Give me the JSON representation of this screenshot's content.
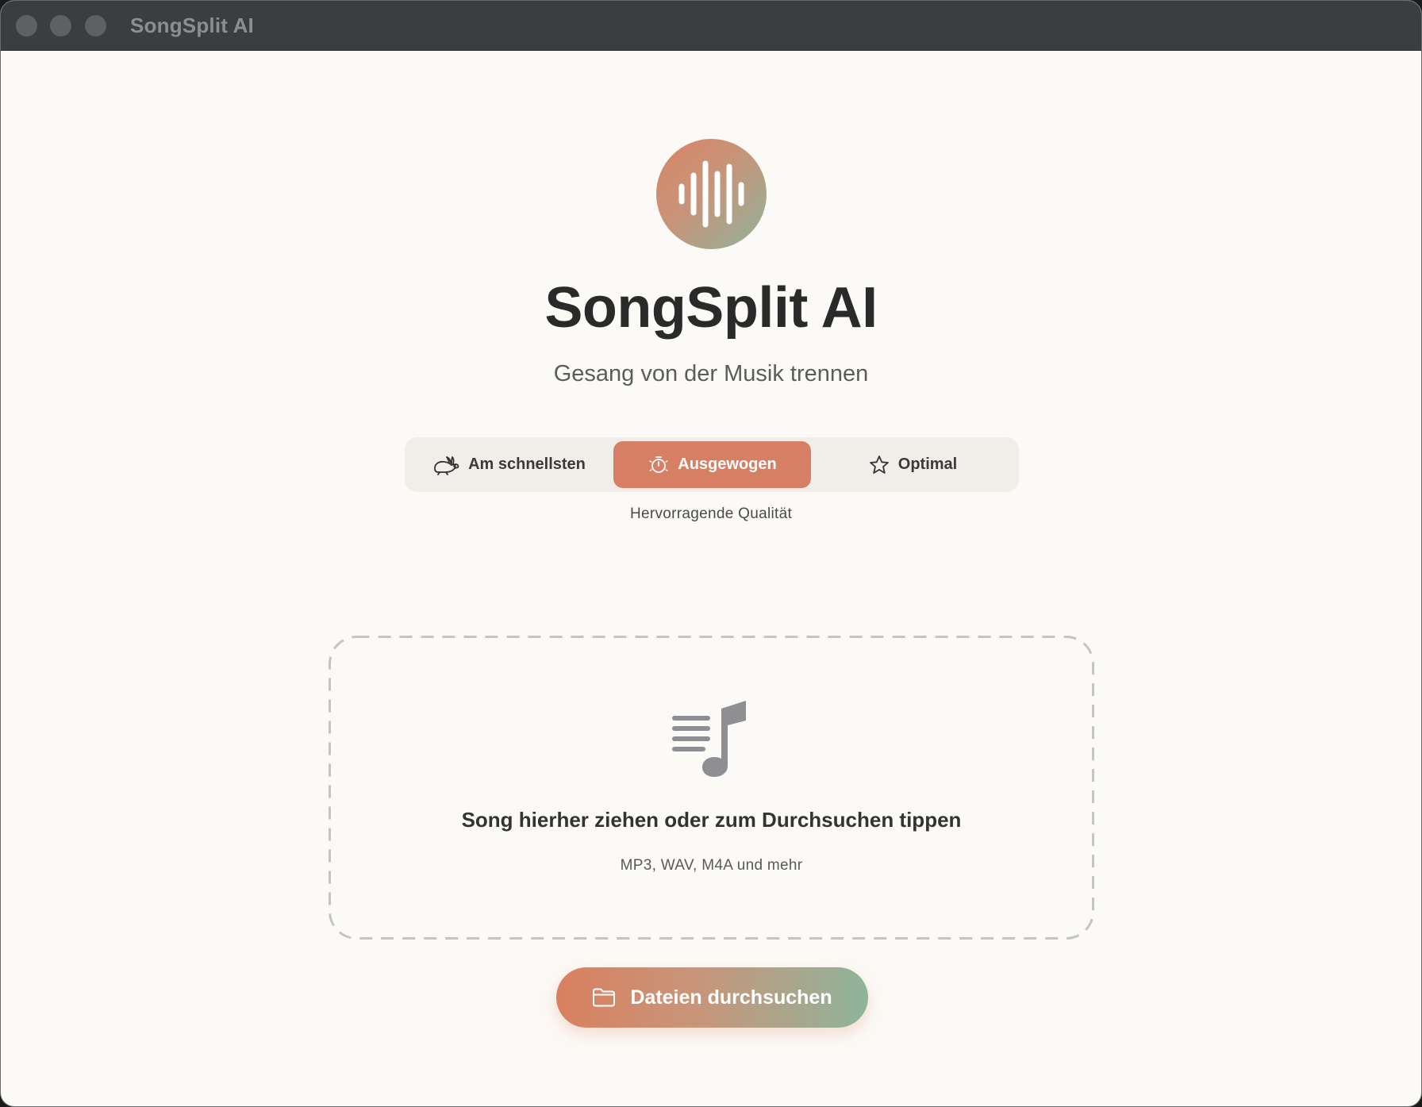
{
  "window": {
    "title": "SongSplit AI"
  },
  "header": {
    "app_name": "SongSplit AI",
    "subtitle": "Gesang von der Musik trennen",
    "logo_icon": "waveform-icon"
  },
  "quality": {
    "options": [
      {
        "label": "Am schnellsten",
        "icon": "rabbit-icon",
        "selected": false
      },
      {
        "label": "Ausgewogen",
        "icon": "timer-icon",
        "selected": true
      },
      {
        "label": "Optimal",
        "icon": "star-icon",
        "selected": false
      }
    ],
    "caption": "Hervorragende Qualität"
  },
  "dropzone": {
    "icon": "music-list-icon",
    "title": "Song hierher ziehen oder zum Durchsuchen tippen",
    "formats": "MP3, WAV, M4A und mehr"
  },
  "browse": {
    "label": "Dateien durchsuchen",
    "icon": "folder-icon"
  },
  "colors": {
    "accent": "#d67f64",
    "accent_green": "#8fb49b",
    "background": "#fcfaf6",
    "titlebar": "#3a3e40"
  }
}
